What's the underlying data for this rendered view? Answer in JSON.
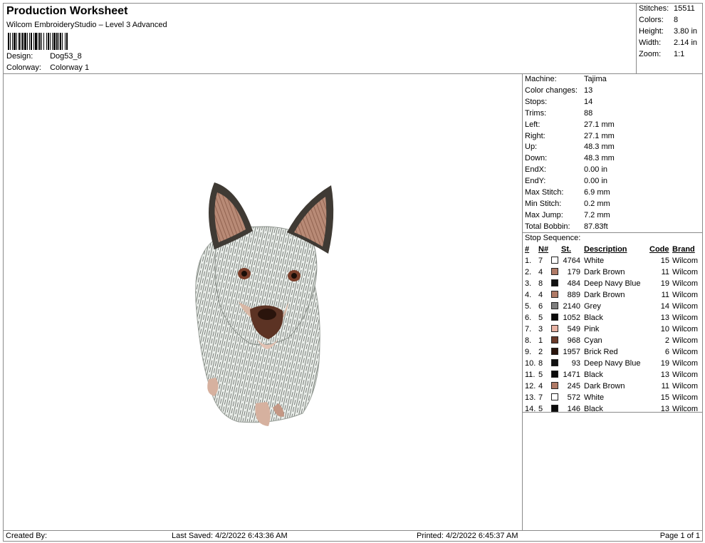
{
  "header": {
    "title": "Production Worksheet",
    "subtitle": "Wilcom EmbroideryStudio – Level 3 Advanced",
    "design_label": "Design:",
    "design_value": "Dog53_8",
    "colorway_label": "Colorway:",
    "colorway_value": "Colorway 1"
  },
  "stats": [
    {
      "label": "Stitches:",
      "value": "15511"
    },
    {
      "label": "Colors:",
      "value": "8"
    },
    {
      "label": "Height:",
      "value": "3.80 in"
    },
    {
      "label": "Width:",
      "value": "2.14 in"
    },
    {
      "label": "Zoom:",
      "value": "1:1"
    }
  ],
  "machine_info": [
    {
      "label": "Machine:",
      "value": "Tajima"
    },
    {
      "label": "Color changes:",
      "value": "13"
    },
    {
      "label": "Stops:",
      "value": "14"
    },
    {
      "label": "Trims:",
      "value": "88"
    },
    {
      "label": "Left:",
      "value": "27.1 mm"
    },
    {
      "label": "Right:",
      "value": "27.1 mm"
    },
    {
      "label": "Up:",
      "value": "48.3 mm"
    },
    {
      "label": "Down:",
      "value": "48.3 mm"
    },
    {
      "label": "EndX:",
      "value": "0.00 in"
    },
    {
      "label": "EndY:",
      "value": "0.00 in"
    },
    {
      "label": "Max Stitch:",
      "value": "6.9 mm"
    },
    {
      "label": "Min Stitch:",
      "value": "0.2 mm"
    },
    {
      "label": "Max Jump:",
      "value": "7.2 mm"
    },
    {
      "label": "Total Bobbin:",
      "value": "87.83ft"
    }
  ],
  "stop_sequence": {
    "title": "Stop Sequence:",
    "headers": {
      "idx": "#",
      "n": "N#",
      "st": "St.",
      "desc": "Description",
      "code": "Code",
      "brand": "Brand"
    },
    "rows": [
      {
        "idx": "1.",
        "n": "7",
        "color": "#ffffff",
        "st": "4764",
        "desc": "White",
        "code": "15",
        "brand": "Wilcom"
      },
      {
        "idx": "2.",
        "n": "4",
        "color": "#b07a66",
        "st": "179",
        "desc": "Dark Brown",
        "code": "11",
        "brand": "Wilcom"
      },
      {
        "idx": "3.",
        "n": "8",
        "color": "#111111",
        "st": "484",
        "desc": "Deep Navy Blue",
        "code": "19",
        "brand": "Wilcom"
      },
      {
        "idx": "4.",
        "n": "4",
        "color": "#b07a66",
        "st": "889",
        "desc": "Dark Brown",
        "code": "11",
        "brand": "Wilcom"
      },
      {
        "idx": "5.",
        "n": "6",
        "color": "#7f7f7f",
        "st": "2140",
        "desc": "Grey",
        "code": "14",
        "brand": "Wilcom"
      },
      {
        "idx": "6.",
        "n": "5",
        "color": "#0b0b0b",
        "st": "1052",
        "desc": "Black",
        "code": "13",
        "brand": "Wilcom"
      },
      {
        "idx": "7.",
        "n": "3",
        "color": "#e8b3a4",
        "st": "549",
        "desc": "Pink",
        "code": "10",
        "brand": "Wilcom"
      },
      {
        "idx": "8.",
        "n": "1",
        "color": "#6b3a2a",
        "st": "968",
        "desc": "Cyan",
        "code": "2",
        "brand": "Wilcom"
      },
      {
        "idx": "9.",
        "n": "2",
        "color": "#2a140c",
        "st": "1957",
        "desc": "Brick Red",
        "code": "6",
        "brand": "Wilcom"
      },
      {
        "idx": "10.",
        "n": "8",
        "color": "#111111",
        "st": "93",
        "desc": "Deep Navy Blue",
        "code": "19",
        "brand": "Wilcom"
      },
      {
        "idx": "11.",
        "n": "5",
        "color": "#0b0b0b",
        "st": "1471",
        "desc": "Black",
        "code": "13",
        "brand": "Wilcom"
      },
      {
        "idx": "12.",
        "n": "4",
        "color": "#b07a66",
        "st": "245",
        "desc": "Dark Brown",
        "code": "11",
        "brand": "Wilcom"
      },
      {
        "idx": "13.",
        "n": "7",
        "color": "#ffffff",
        "st": "572",
        "desc": "White",
        "code": "15",
        "brand": "Wilcom"
      },
      {
        "idx": "14.",
        "n": "5",
        "color": "#0b0b0b",
        "st": "146",
        "desc": "Black",
        "code": "13",
        "brand": "Wilcom"
      }
    ]
  },
  "footer": {
    "created_by": "Created By:",
    "last_saved": "Last Saved: 4/2/2022 6:43:36 AM",
    "printed": "Printed: 4/2/2022 6:45:37 AM",
    "page": "Page 1 of 1"
  }
}
